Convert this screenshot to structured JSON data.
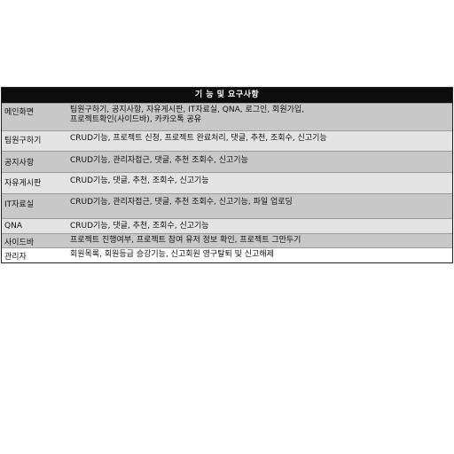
{
  "table": {
    "title": "기 능 및 요구사항",
    "rows": [
      {
        "label": "메인화면",
        "desc": " 팀원구하기, 공지사항, 자유게시판, IT자료실, QNA, 로그인, 회원가입,\n 프로젝트확인(사이드바), 카카오톡 공유"
      },
      {
        "label": "팀원구하기",
        "desc": " CRUD기능, 프로젝트 신청, 프로젝트 완료처리, 댓글, 추천, 조회수, 신고기능"
      },
      {
        "label": "공지사항",
        "desc": "CRUD기능, 관리자접근, 댓글, 추천 조회수, 신고기능"
      },
      {
        "label": "자유게시판",
        "desc": "CRUD기능, 댓글, 추천, 조회수, 신고기능"
      },
      {
        "label": "IT자료실",
        "desc": "CRUD기능, 관리자접근, 댓글, 추천 조회수, 신고기능, 파일 업로딩"
      },
      {
        "label": "QNA",
        "desc": "CRUD기능, 댓글, 추천, 조회수, 신고기능"
      },
      {
        "label": "사이드바",
        "desc": "프로젝트 진행여부, 프로젝트 참여 유저 정보 확인, 프로젝트 그만두기"
      },
      {
        "label": "관리자",
        "desc": "회원목록, 회원등급 승강기능, 신고회원 영구탈퇴 및 신고해제"
      }
    ]
  }
}
